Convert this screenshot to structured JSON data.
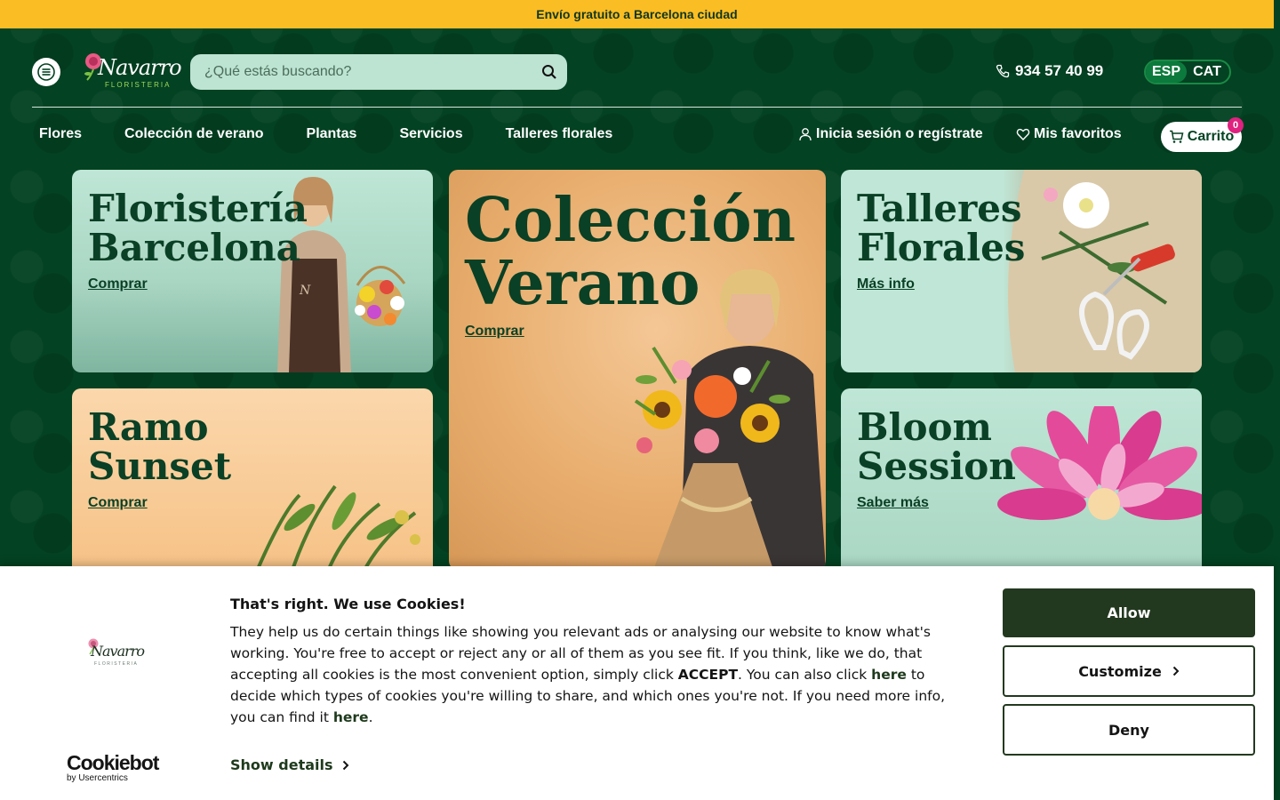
{
  "topbar": {
    "text": "Envío gratuito a Barcelona ciudad"
  },
  "header": {
    "logo_main": "Navarro",
    "logo_sub": "FLORISTERIA",
    "search_placeholder": "¿Qué estás buscando?",
    "phone": "934 57 40 99",
    "lang_active": "ESP",
    "lang_other": "CAT"
  },
  "nav": {
    "items": [
      "Flores",
      "Colección de verano",
      "Plantas",
      "Servicios",
      "Talleres florales"
    ],
    "account": "Inicia sesión o regístrate",
    "favorites": "Mis favoritos",
    "cart": "Carrito",
    "cart_count": "0"
  },
  "cards": [
    {
      "title_l1": "Floristería",
      "title_l2": "Barcelona",
      "cta": "Comprar"
    },
    {
      "title_l1": "Colección",
      "title_l2": "Verano",
      "cta": "Comprar"
    },
    {
      "title_l1": "Talleres",
      "title_l2": "Florales",
      "cta": "Más info"
    },
    {
      "title_l1": "Ramo",
      "title_l2": "Sunset",
      "cta": "Comprar"
    },
    {
      "title_l1": "Bloom",
      "title_l2": "Session",
      "cta": "Saber más"
    }
  ],
  "cookie": {
    "title": "That's right. We use Cookies!",
    "text_1": "They help us do certain things like showing you relevant ads or analysing our website to know what's working. You're free to accept or reject any or all of them as you see fit. If you think, like we do, that accepting all cookies is the most convenient option, simply click ",
    "accept_word": "ACCEPT",
    "text_2": ". You can also click ",
    "here_1": "here",
    "text_3": " to decide which types of cookies you're willing to share, and which ones you're not. If you need more info, you can find it ",
    "here_2": "here",
    "text_4": ".",
    "show_details": "Show details",
    "allow": "Allow",
    "customize": "Customize",
    "deny": "Deny",
    "brand": "Cookiebot",
    "brand_sub": "by Usercentrics",
    "logo_main": "Navarro",
    "logo_sub": "FLORISTERIA"
  },
  "colors": {
    "brand_green": "#034222",
    "topbar_yellow": "#fbbd24",
    "accent_pink": "#e0217f",
    "button_dark": "#23391f"
  }
}
